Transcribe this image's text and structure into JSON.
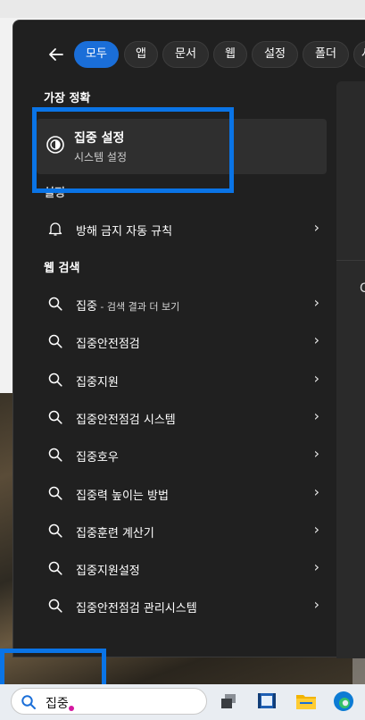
{
  "filters": {
    "back_icon": "arrow-left-icon",
    "items": [
      "모두",
      "앱",
      "문서",
      "웹",
      "설정",
      "폴더",
      "사"
    ],
    "active_index": 0
  },
  "best_match": {
    "heading": "가장 정확",
    "title": "집중 설정",
    "subtitle": "시스템 설정",
    "icon": "focus-clock-icon"
  },
  "settings": {
    "heading": "설정",
    "items": [
      {
        "label": "방해 금지 자동 규칙",
        "icon": "bell-icon"
      }
    ]
  },
  "web": {
    "heading": "웹 검색",
    "items": [
      {
        "label": "집중",
        "suffix": " - 검색 결과 더 보기"
      },
      {
        "label": "집중안전점검",
        "suffix": ""
      },
      {
        "label": "집중지원",
        "suffix": ""
      },
      {
        "label": "집중안전점검 시스템",
        "suffix": ""
      },
      {
        "label": "집중호우",
        "suffix": ""
      },
      {
        "label": "집중력 높이는 방법",
        "suffix": ""
      },
      {
        "label": "집중훈련 계산기",
        "suffix": ""
      },
      {
        "label": "집중지원설정",
        "suffix": ""
      },
      {
        "label": "집중안전점검 관리시스템",
        "suffix": ""
      }
    ]
  },
  "preview": {
    "partial_text": "C"
  },
  "taskbar": {
    "search_value": "집중",
    "accent": "#1a6ed8",
    "icons": [
      "task-view-icon",
      "media-player-icon",
      "file-explorer-icon",
      "edge-browser-icon"
    ]
  },
  "highlight_color": "#0a74e6"
}
